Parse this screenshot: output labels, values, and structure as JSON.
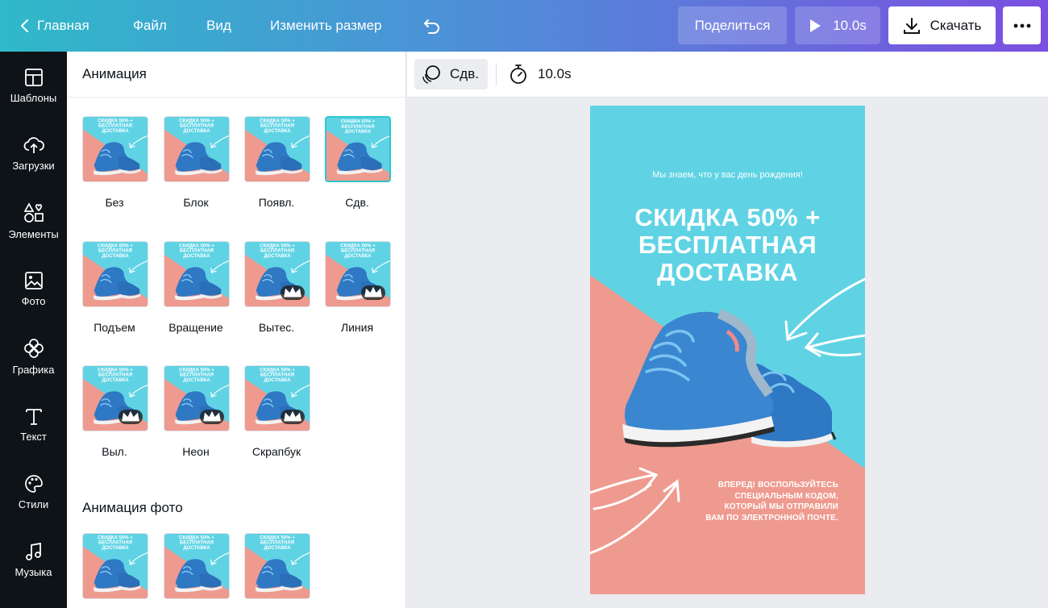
{
  "topbar": {
    "home_label": "Главная",
    "file_label": "Файл",
    "view_label": "Вид",
    "resize_label": "Изменить размер",
    "share_label": "Поделиться",
    "play_label": "10.0s",
    "download_label": "Скачать"
  },
  "rail": {
    "items": [
      {
        "label": "Шаблоны",
        "icon": "templates-icon"
      },
      {
        "label": "Загрузки",
        "icon": "upload-icon"
      },
      {
        "label": "Элементы",
        "icon": "elements-icon"
      },
      {
        "label": "Фото",
        "icon": "photo-icon"
      },
      {
        "label": "Графика",
        "icon": "graphics-icon"
      },
      {
        "label": "Текст",
        "icon": "text-icon"
      },
      {
        "label": "Стили",
        "icon": "palette-icon"
      },
      {
        "label": "Музыка",
        "icon": "music-icon"
      }
    ]
  },
  "panel": {
    "title": "Анимация",
    "animations": [
      {
        "label": "Без",
        "premium": false,
        "selected": false
      },
      {
        "label": "Блок",
        "premium": false,
        "selected": false
      },
      {
        "label": "Появл.",
        "premium": false,
        "selected": false
      },
      {
        "label": "Сдв.",
        "premium": false,
        "selected": true
      },
      {
        "label": "Подъем",
        "premium": false,
        "selected": false
      },
      {
        "label": "Вращение",
        "premium": false,
        "selected": false
      },
      {
        "label": "Вытес.",
        "premium": true,
        "selected": false
      },
      {
        "label": "Линия",
        "premium": true,
        "selected": false
      },
      {
        "label": "Выл.",
        "premium": true,
        "selected": false
      },
      {
        "label": "Неон",
        "premium": true,
        "selected": false
      },
      {
        "label": "Скрапбук",
        "premium": true,
        "selected": false
      }
    ],
    "photo_section_title": "Анимация фото",
    "thumb_text": [
      "СКИДКА 50% +",
      "БЕСПЛАТНАЯ",
      "ДОСТАВКА"
    ]
  },
  "toolbar": {
    "effect_label": "Сдв.",
    "duration_label": "10.0s"
  },
  "canvas": {
    "subtitle": "Мы знаем, что у вас день рождения!",
    "headline_line1": "СКИДКА 50% +",
    "headline_line2": "БЕСПЛАТНАЯ",
    "headline_line3": "ДОСТАВКА",
    "footer_line1": "ВПЕРЕД! ВОСПОЛЬЗУЙТЕСЬ",
    "footer_line2": "СПЕЦИАЛЬНЫМ КОДОМ,",
    "footer_line3": "КОТОРЫЙ МЫ ОТПРАВИЛИ",
    "footer_line4": "ВАМ ПО ЭЛЕКТРОННОЙ ПОЧТЕ."
  },
  "colors": {
    "teal": "#5fd3e4",
    "salmon": "#ef9a8f",
    "rail_bg": "#0e1318",
    "shoe_blue": "#2f78c4"
  }
}
